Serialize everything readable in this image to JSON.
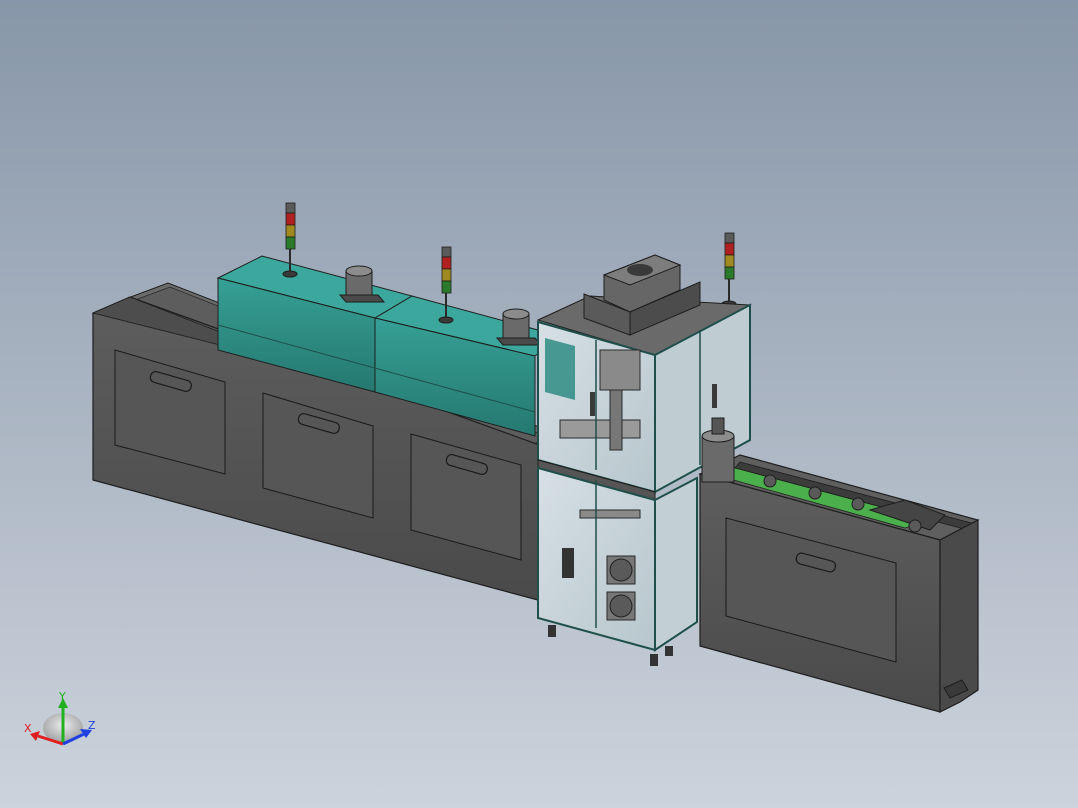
{
  "viewport": {
    "background_top": "#8796a8",
    "background_bottom": "#ccd3dc"
  },
  "model": {
    "description_icon": "cad-assembly-icon",
    "colors": {
      "housing": "#555555",
      "housing_dark": "#3e3e3e",
      "housing_top": "#6a6a6a",
      "outline": "#1e1e1e",
      "oven_cover": "#2f8c84",
      "oven_cover_top": "#3aa39a",
      "frame": "#1f4f4a",
      "glass": "#c9d6dc",
      "signal_red": "#b02020",
      "signal_yellow": "#a08a20",
      "signal_green": "#2b7a2b",
      "conveyor_green": "#4bb04b"
    }
  },
  "triad": {
    "x_label": "X",
    "y_label": "Y",
    "z_label": "Z",
    "x_color": "#e02020",
    "y_color": "#20b020",
    "z_color": "#2040e0"
  }
}
